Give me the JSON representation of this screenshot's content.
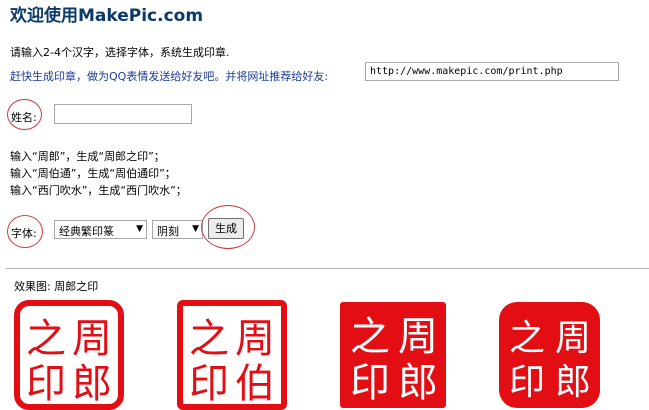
{
  "header": {
    "title": "欢迎使用MakePic.com"
  },
  "intro": {
    "instruction": "请输入2-4个汉字，选择字体，系统生成印章.",
    "share_text": "赶快生成印章，做为QQ表情发送给好友吧。并将网址推荐给好友:",
    "share_url": "http://www.makepic.com/print.php"
  },
  "form": {
    "name_label": "姓名:",
    "name_value": "",
    "examples": [
      "输入“周郎”，生成“周郎之印”；",
      "输入“周伯通”，生成“周伯通印”；",
      "输入“西门吹水”，生成“西门吹水”；"
    ],
    "font_label": "字体:",
    "font_select": "经典繁印篆",
    "style_select": "阴刻",
    "generate_label": "生成"
  },
  "result": {
    "label": "效果图: 周郎之印",
    "seals": [
      {
        "style": "outline",
        "chars": [
          "周",
          "郎",
          "之",
          "印"
        ]
      },
      {
        "style": "outline",
        "chars": [
          "周",
          "伯",
          "之",
          "印"
        ]
      },
      {
        "style": "solid",
        "chars": [
          "周",
          "郎",
          "之",
          "印"
        ]
      },
      {
        "style": "solid",
        "chars": [
          "周",
          "郎",
          "之",
          "印"
        ]
      }
    ],
    "seal_color": "#e30d14"
  }
}
